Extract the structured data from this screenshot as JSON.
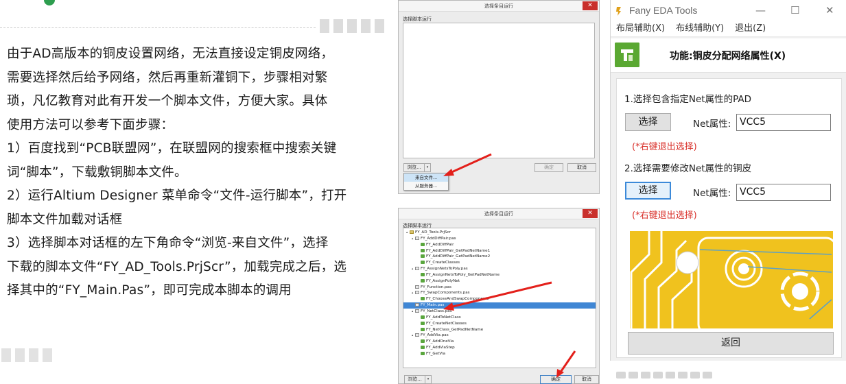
{
  "article": {
    "lines": [
      "由于AD高版本的铜皮设置网络，无法直接设定铜皮网络，",
      "需要选择然后给予网络，然后再重新灌铜下，步骤相对繁",
      "琐，凡亿教育对此有开发一个脚本文件，方便大家。具体",
      "使用方法可以参考下面步骤：",
      "1）百度找到“PCB联盟网”，在联盟网的搜索框中搜索关键",
      "词“脚本”，下载敷铜脚本文件。",
      "2）运行Altium Designer 菜单命令“文件-运行脚本”，打开",
      "脚本文件加载对话框",
      "3）选择脚本对话框的左下角命令“浏览-来自文件”，选择",
      "下载的脚本文件“FY_AD_Tools.PrjScr”，加载完成之后，选",
      "择其中的“FY_Main.Pas”，即可完成本脚本的调用"
    ]
  },
  "dialog1": {
    "title": "选择条目运行",
    "close_glyph": "✕",
    "list_label": "选择脚本运行",
    "browse_label": "浏览...",
    "browse_arrow": "▾",
    "ok_label": "确定",
    "cancel_label": "取消",
    "dropdown": [
      "来自文件...",
      "从服务器..."
    ]
  },
  "dialog2": {
    "title": "选择条目运行",
    "close_glyph": "✕",
    "list_label": "选择脚本运行",
    "browse_label": "浏览...",
    "browse_arrow": "▾",
    "ok_label": "确定",
    "cancel_label": "取消",
    "tree": [
      {
        "text": "FY_AD_Tools.PrjScr",
        "level": 0,
        "kind": "proj",
        "toggle": "▴"
      },
      {
        "text": "FY_AddDiffPair.pas",
        "level": 1,
        "kind": "file",
        "toggle": "▴"
      },
      {
        "text": "FY_AddDiffPair",
        "level": 2,
        "kind": "proc",
        "toggle": ""
      },
      {
        "text": "FY_AddDiffPair_GetPadNetName1",
        "level": 2,
        "kind": "proc",
        "toggle": ""
      },
      {
        "text": "FY_AddDiffPair_GetPadNetName2",
        "level": 2,
        "kind": "proc",
        "toggle": ""
      },
      {
        "text": "FY_CreateClasses",
        "level": 2,
        "kind": "proc",
        "toggle": ""
      },
      {
        "text": "FY_AssignNetsToPoly.pas",
        "level": 1,
        "kind": "file",
        "toggle": "▴"
      },
      {
        "text": "FY_AssignNetsToPoly_GetPadNetName",
        "level": 2,
        "kind": "proc",
        "toggle": ""
      },
      {
        "text": "FY_AssignPolyNet",
        "level": 2,
        "kind": "proc",
        "toggle": ""
      },
      {
        "text": "FY_Function.pas",
        "level": 1,
        "kind": "file",
        "toggle": ""
      },
      {
        "text": "FY_SwapComponents.pas",
        "level": 1,
        "kind": "file",
        "toggle": "▴"
      },
      {
        "text": "FY_ChooseAndSwapComponents",
        "level": 2,
        "kind": "proc",
        "toggle": ""
      },
      {
        "text": "FY_Main.pas",
        "level": 1,
        "kind": "file",
        "toggle": "",
        "selected": true
      },
      {
        "text": "FY_NetClass.pas",
        "level": 1,
        "kind": "file",
        "toggle": "▴"
      },
      {
        "text": "FY_AddToNetClass",
        "level": 2,
        "kind": "proc",
        "toggle": ""
      },
      {
        "text": "FY_CreateNetClasses",
        "level": 2,
        "kind": "proc",
        "toggle": ""
      },
      {
        "text": "FY_NetClass_GetPadNetName",
        "level": 2,
        "kind": "proc",
        "toggle": ""
      },
      {
        "text": "FY_AddVia.pas",
        "level": 1,
        "kind": "file",
        "toggle": "▴"
      },
      {
        "text": "FY_AddOneVia",
        "level": 2,
        "kind": "proc",
        "toggle": ""
      },
      {
        "text": "FY_AddViaStep",
        "level": 2,
        "kind": "proc",
        "toggle": ""
      },
      {
        "text": "FY_GetVia",
        "level": 2,
        "kind": "proc",
        "toggle": ""
      }
    ]
  },
  "fany": {
    "app_name": "Fany EDA Tools",
    "win_minimize": "—",
    "win_maximize": "☐",
    "win_close": "✕",
    "menu": [
      "布局辅助(X)",
      "布线辅助(Y)",
      "退出(Z)"
    ],
    "function_title": "功能:铜皮分配网络属性(X)",
    "step1": "1.选择包含指定Net属性的PAD",
    "step2": "2.选择需要修改Net属性的铜皮",
    "select_label": "选择",
    "net_label": "Net属性:",
    "net_value1": "VCC5",
    "net_value2": "VCC5",
    "hint": "(*右键退出选择)",
    "back_label": "返回"
  },
  "colors": {
    "pcb_copper": "#f0c21e",
    "pcb_line": "#ffffff",
    "hint_red": "#d9312b",
    "arrow_red": "#e3201b",
    "selected_blue": "#3f86d4",
    "logo_green": "#5aa832"
  }
}
